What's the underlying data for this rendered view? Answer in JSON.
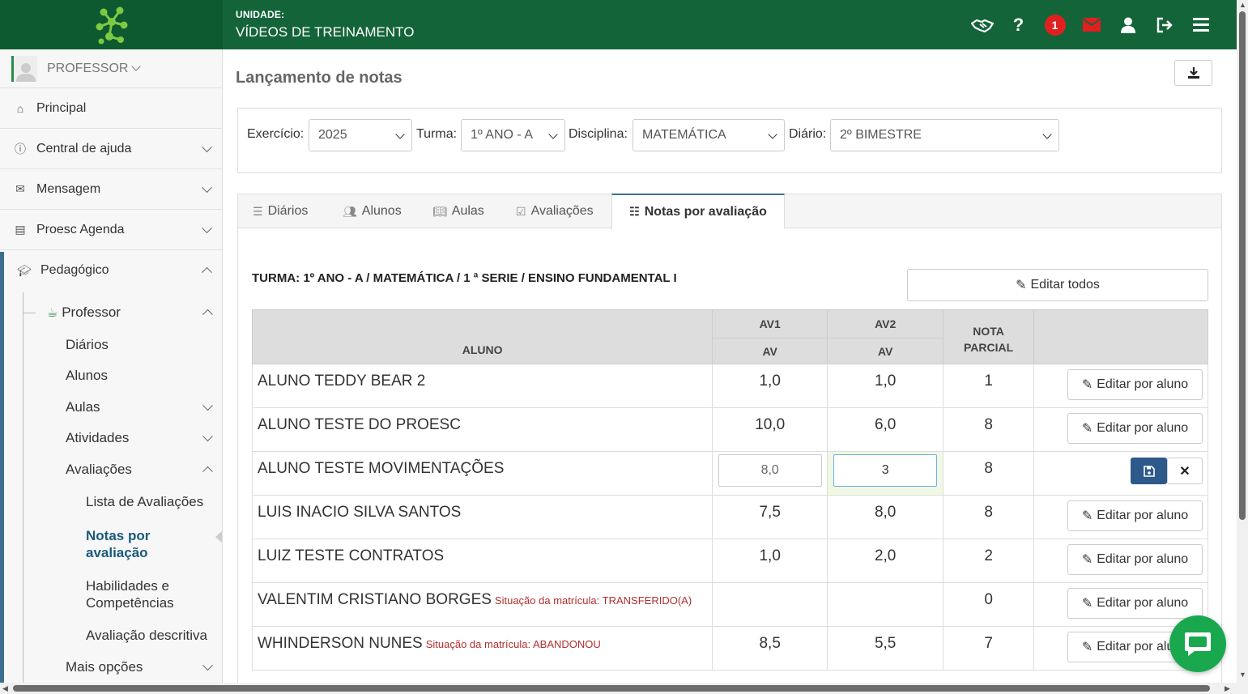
{
  "header": {
    "unit_label": "UNIDADE:",
    "unit_name": "VÍDEOS DE TREINAMENTO",
    "notification_count": "1"
  },
  "sidebar": {
    "profile": "PROFESSOR",
    "items": [
      {
        "label": "Principal"
      },
      {
        "label": "Central de ajuda"
      },
      {
        "label": "Mensagem"
      },
      {
        "label": "Proesc Agenda"
      },
      {
        "label": "Pedagógico"
      }
    ],
    "professor": "Professor",
    "sub": {
      "diarios": "Diários",
      "alunos": "Alunos",
      "aulas": "Aulas",
      "atividades": "Atividades",
      "avaliacoes": "Avaliações",
      "lista": "Lista de Avaliações",
      "notas_1": "Notas por",
      "notas_2": "avaliação",
      "habilidades_1": "Habilidades e",
      "habilidades_2": "Competências",
      "descritiva": "Avaliação descritiva",
      "mais": "Mais opções"
    }
  },
  "main": {
    "title": "Lançamento de notas",
    "filters": {
      "exercicio_label": "Exercício:",
      "exercicio": "2025",
      "turma_label": "Turma:",
      "turma": "1º ANO - A",
      "disciplina_label": "Disciplina:",
      "disciplina": "MATEMÁTICA",
      "diario_label": "Diário:",
      "diario": "2º BIMESTRE"
    },
    "tabs": [
      {
        "label": "Diários"
      },
      {
        "label": "Alunos"
      },
      {
        "label": "Aulas"
      },
      {
        "label": "Avaliações"
      },
      {
        "label": "Notas por avaliação"
      }
    ],
    "turma_text": "TURMA: 1º ANO - A / MATEMÁTICA / 1 ª SERIE / ENSINO FUNDAMENTAL I",
    "edit_all_label": "Editar todos",
    "table": {
      "col_aluno": "ALUNO",
      "col_av1": "AV1",
      "col_av2": "AV2",
      "col_av_sub": "AV",
      "col_nota_1": "NOTA",
      "col_nota_2": "PARCIAL",
      "edit_label": "Editar por aluno",
      "rows": [
        {
          "name": "ALUNO TEDDY BEAR 2",
          "situacao": "",
          "av1": "1,0",
          "av2": "1,0",
          "nota": "1"
        },
        {
          "name": "ALUNO TESTE DO PROESC",
          "situacao": "",
          "av1": "10,0",
          "av2": "6,0",
          "nota": "8"
        },
        {
          "name": "ALUNO TESTE MOVIMENTAÇÕES",
          "situacao": "",
          "av1": "8,0",
          "av2": "3",
          "nota": "8"
        },
        {
          "name": "LUIS INACIO SILVA SANTOS",
          "situacao": "",
          "av1": "7,5",
          "av2": "8,0",
          "nota": "8"
        },
        {
          "name": "LUIZ TESTE CONTRATOS",
          "situacao": "",
          "av1": "1,0",
          "av2": "2,0",
          "nota": "2"
        },
        {
          "name": "VALENTIM CRISTIANO BORGES",
          "situacao": "Situação da matrícula: TRANSFERIDO(A)",
          "av1": "",
          "av2": "",
          "nota": "0"
        },
        {
          "name": "WHINDERSON NUNES",
          "situacao": "Situação da matrícula: ABANDONOU",
          "av1": "8,5",
          "av2": "5,5",
          "nota": "7"
        }
      ]
    }
  },
  "colors": {
    "header_green": "#14643a",
    "fail_red": "#e02020",
    "accent_blue": "#2d5a8a",
    "chat_green": "#1aa84f"
  }
}
